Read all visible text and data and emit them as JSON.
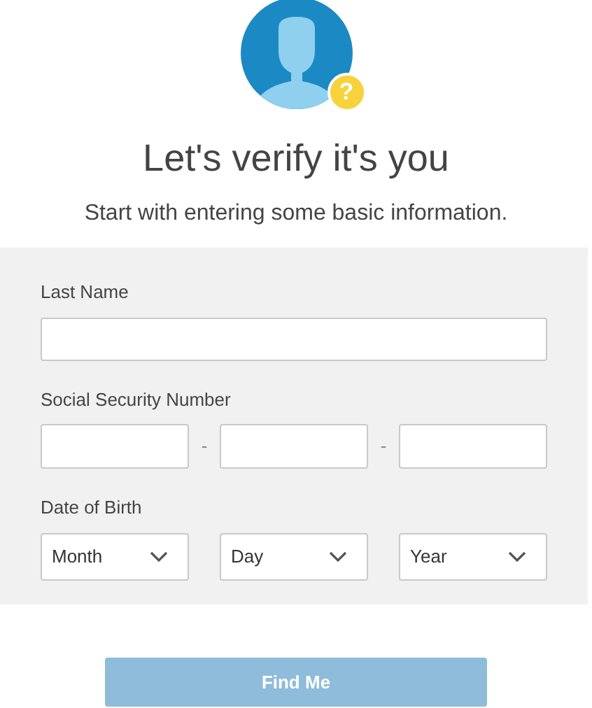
{
  "avatar": {
    "badge": "?"
  },
  "title": "Let's verify it's you",
  "subtitle": "Start with entering some basic information.",
  "form": {
    "last_name": {
      "label": "Last Name"
    },
    "ssn": {
      "label": "Social Security Number",
      "separators": [
        "-",
        "-"
      ]
    },
    "dob": {
      "label": "Date of Birth",
      "selects": [
        {
          "value": "Month"
        },
        {
          "value": "Day"
        },
        {
          "value": "Year"
        }
      ]
    }
  },
  "button": {
    "label": "Find Me",
    "disabled": true
  }
}
